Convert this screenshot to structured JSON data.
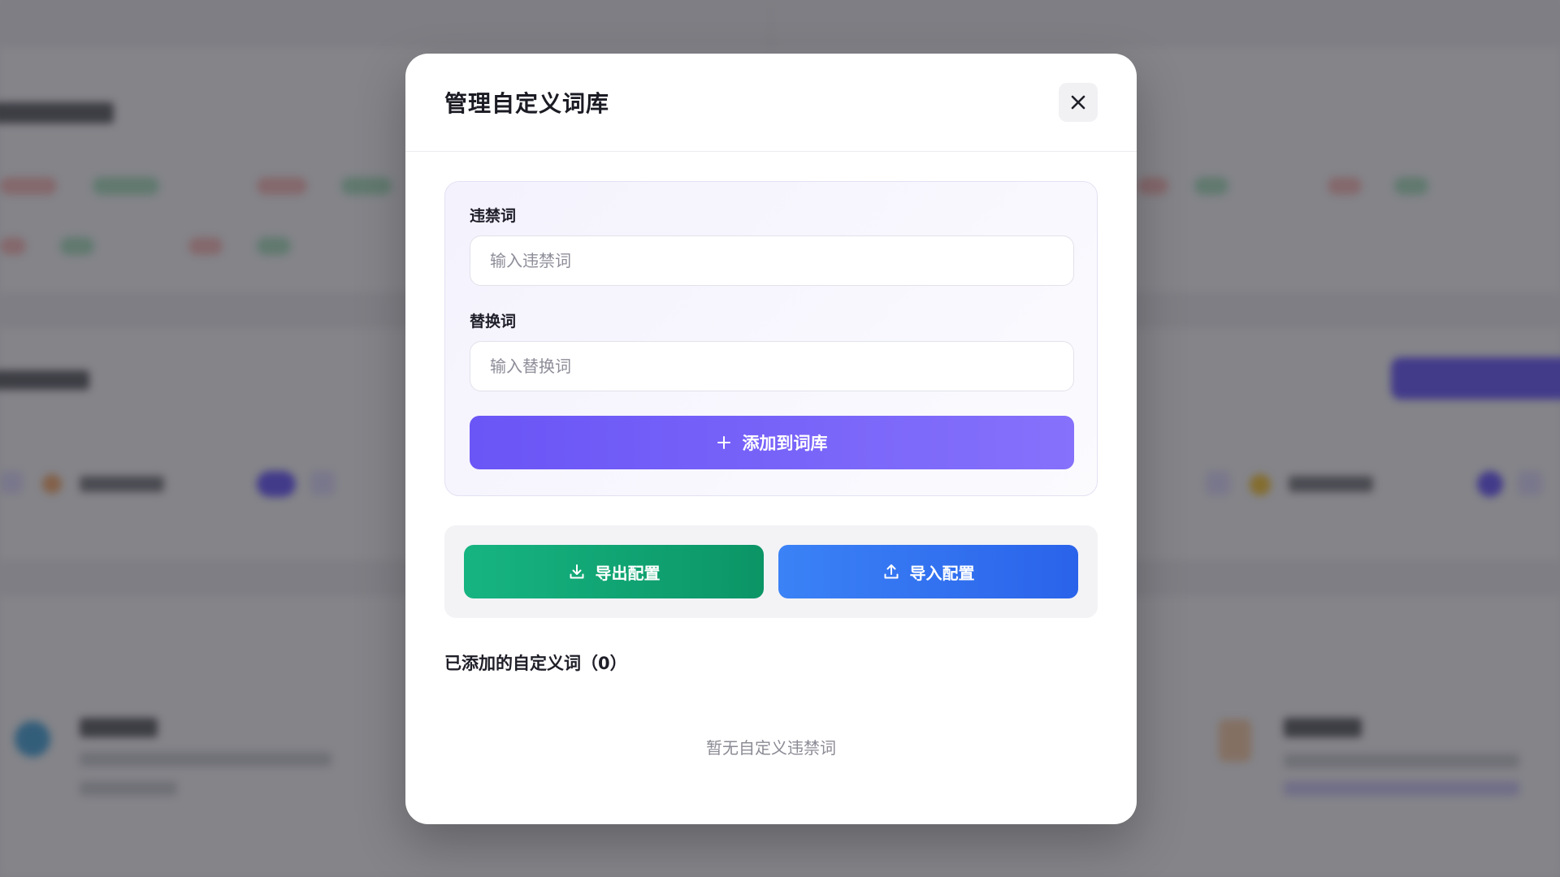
{
  "modal": {
    "title": "管理自定义词库",
    "close_icon": "close-icon"
  },
  "form": {
    "banned_word_label": "违禁词",
    "banned_word_placeholder": "输入违禁词",
    "banned_word_value": "",
    "replacement_label": "替换词",
    "replacement_placeholder": "输入替换词",
    "replacement_value": "",
    "add_button": {
      "icon": "plus-icon",
      "label": "添加到词库"
    }
  },
  "config_actions": {
    "export": {
      "icon": "download-icon",
      "label": "导出配置",
      "color": "#10b981"
    },
    "import": {
      "icon": "upload-icon",
      "label": "导入配置",
      "color": "#3b82f6"
    }
  },
  "custom_words": {
    "title": "已添加的自定义词（0）",
    "count": 0,
    "items": [],
    "empty_text": "暂无自定义违禁词"
  },
  "colors": {
    "accent": "#6c5ce7",
    "overlay": "rgba(30,30,36,0.52)"
  }
}
